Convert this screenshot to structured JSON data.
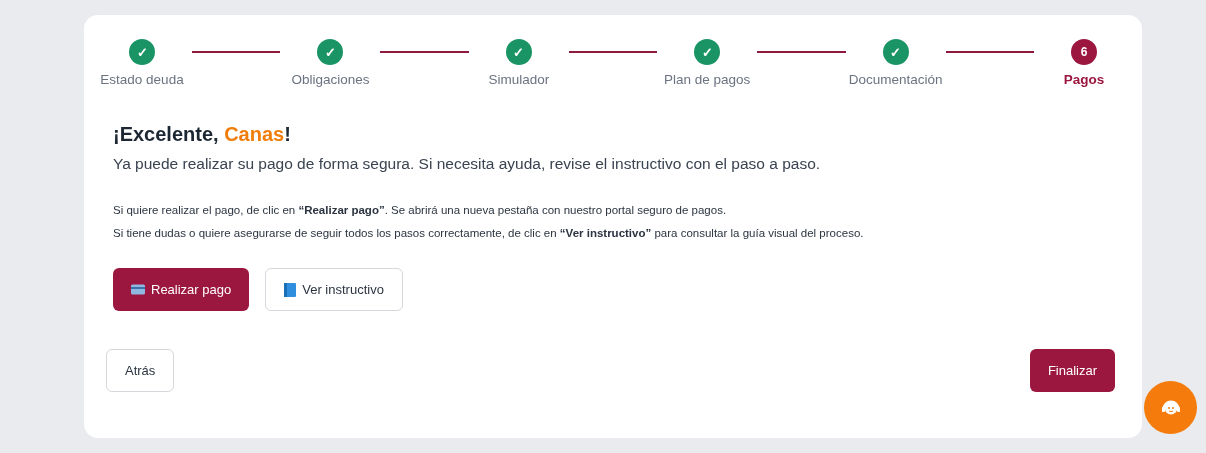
{
  "steps": [
    {
      "label": "Estado deuda",
      "mark": "✓",
      "completed": true,
      "selected": false
    },
    {
      "label": "Obligaciones",
      "mark": "✓",
      "completed": true,
      "selected": false
    },
    {
      "label": "Simulador",
      "mark": "✓",
      "completed": true,
      "selected": false
    },
    {
      "label": "Plan de pagos",
      "mark": "✓",
      "completed": true,
      "selected": false
    },
    {
      "label": "Documentación",
      "mark": "✓",
      "completed": true,
      "selected": false
    },
    {
      "label": "Pagos",
      "mark": "6",
      "completed": false,
      "selected": true
    }
  ],
  "heading": {
    "prefix": "¡Excelente, ",
    "name": "Canas",
    "suffix": "!"
  },
  "subtitle": "Ya puede realizar su pago de forma segura. Si necesita ayuda, revise el instructivo con el paso a paso.",
  "instructions": [
    "Si quiere realizar el pago, de clic en **“Realizar pago”**. Se abrirá una nueva pestaña con nuestro portal seguro de pagos.",
    "Si tiene dudas o quiere asegurarse de seguir todos los pasos correctamente, de clic en **“Ver instructivo”** para consultar la guía visual del proceso."
  ],
  "actions": [
    {
      "label": "Realizar pago",
      "kind": "primary"
    },
    {
      "label": "Ver instructivo",
      "kind": "outline"
    }
  ],
  "footer": {
    "back": "Atrás",
    "finish": "Finalizar"
  }
}
